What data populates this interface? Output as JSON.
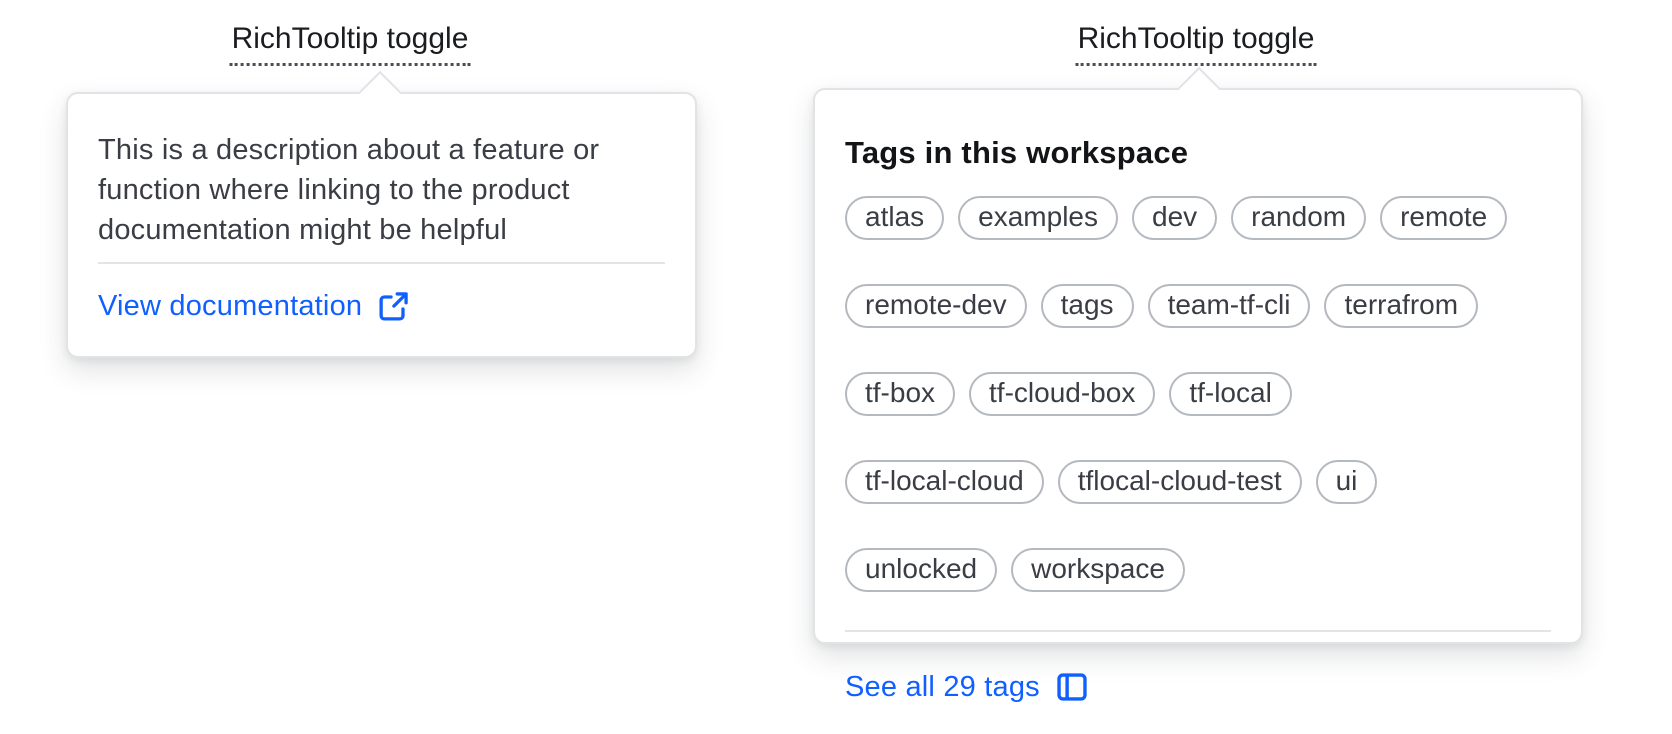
{
  "accent_color": "#1060ff",
  "left_tooltip": {
    "toggle_label": "RichTooltip toggle",
    "description": "This is a description about a feature or function where linking to the product documentation might be helpful",
    "link_label": "View documentation",
    "link_icon": "external-link-icon"
  },
  "right_tooltip": {
    "toggle_label": "RichTooltip toggle",
    "heading": "Tags in this workspace",
    "tags": [
      "atlas",
      "examples",
      "dev",
      "random",
      "remote",
      "remote-dev",
      "tags",
      "team-tf-cli",
      "terrafrom",
      "tf-box",
      "tf-cloud-box",
      "tf-local",
      "tf-local-cloud",
      "tflocal-cloud-test",
      "ui",
      "unlocked",
      "workspace"
    ],
    "tag_total_count": "29",
    "link_label": "See all 29 tags",
    "link_icon": "sidebar-icon"
  }
}
